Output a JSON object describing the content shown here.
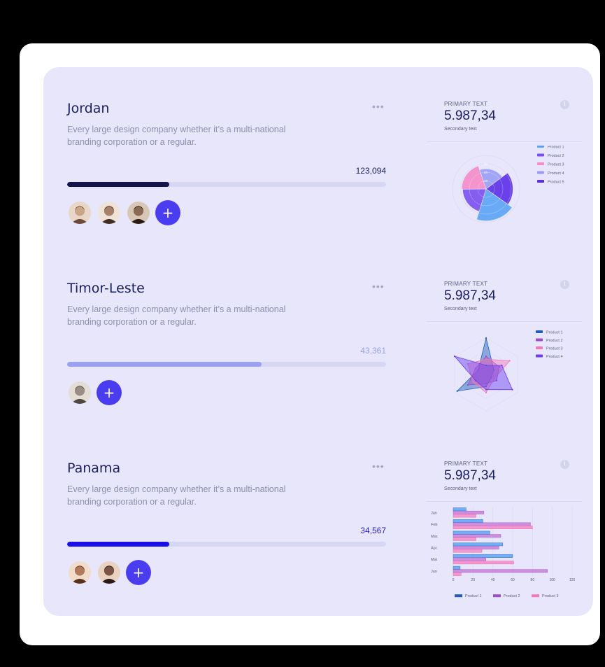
{
  "sections": [
    {
      "title": "Jordan",
      "more": "•••",
      "description": "Every large design company whether it’s a multi-national branding corporation or a regular.",
      "value": "123,094",
      "value_color": "#1a1f5e",
      "progress": 0.32,
      "progress_color": "#14154d",
      "avatar_count": 3,
      "add_label": "+",
      "stat": {
        "label": "PRIMARY TEXT",
        "value": "5.987,34",
        "secondary": "Secondary text",
        "info": "i"
      },
      "chart_data": {
        "type": "polar-area",
        "legend": [
          "Product 1",
          "Product 2",
          "Product 3",
          "Product 4",
          "Product 5"
        ],
        "colors": [
          "#5aa3f5",
          "#7b4ef0",
          "#f58bc7",
          "#9a9cf5",
          "#5b2ee8"
        ],
        "values": [
          38,
          28,
          29,
          24,
          32
        ],
        "r_ticks": [
          10,
          20,
          30
        ],
        "legend_position": "right"
      }
    },
    {
      "title": "Timor-Leste",
      "more": "•••",
      "description": "Every large design company whether it’s a multi-national branding corporation or a regular.",
      "value": "43,361",
      "value_color": "#9a9fe6",
      "progress": 0.61,
      "progress_color": "#9aa0f2",
      "avatar_count": 1,
      "add_label": "+",
      "stat": {
        "label": "PRIMARY TEXT",
        "value": "5.987,34",
        "secondary": "Secondary text",
        "info": "i"
      },
      "chart_data": {
        "type": "radar",
        "legend": [
          "Product 1",
          "Product 2",
          "Product 3",
          "Product 4"
        ],
        "colors": [
          "#1f5db8",
          "#9b4fc9",
          "#f07ab8",
          "#6b3cf0"
        ],
        "series": [
          {
            "name": "Product 1",
            "values": [
              60,
              15,
              10,
              20,
              55,
              15
            ]
          },
          {
            "name": "Product 2",
            "values": [
              30,
              25,
              20,
              15,
              35,
              20
            ]
          },
          {
            "name": "Product 3",
            "values": [
              25,
              45,
              15,
              30,
              25,
              35
            ]
          },
          {
            "name": "Product 4",
            "values": [
              15,
              30,
              50,
              25,
              20,
              60
            ]
          }
        ],
        "legend_position": "right"
      }
    },
    {
      "title": "Panama",
      "more": "•••",
      "description": "Every large design company whether it’s a multi-national branding corporation or a regular.",
      "value": "34,567",
      "value_color": "#2b1fc7",
      "progress": 0.32,
      "progress_color": "#1a0fe6",
      "avatar_count": 2,
      "add_label": "+",
      "stat": {
        "label": "PRIMARY TEXT",
        "value": "5.987,34",
        "secondary": "Secondary text",
        "info": "i"
      },
      "chart_data": {
        "type": "bar",
        "orientation": "horizontal",
        "categories": [
          "Jan",
          "Feb",
          "Mar.",
          "Apr.",
          "Mai",
          "Jun"
        ],
        "x_ticks": [
          0,
          20,
          40,
          60,
          80,
          100,
          120
        ],
        "xlim": [
          0,
          120
        ],
        "legend": [
          "Product 1",
          "Product 2",
          "Product 3"
        ],
        "colors": [
          "#5aa3f5",
          "#c77fd8",
          "#f58bc7"
        ],
        "series": [
          {
            "name": "Product 1",
            "values": [
              13,
              30,
              37,
              50,
              60,
              7
            ]
          },
          {
            "name": "Product 2",
            "values": [
              31,
              78,
              48,
              46,
              33,
              95
            ]
          },
          {
            "name": "Product 3",
            "values": [
              23,
              80,
              23,
              29,
              61,
              8
            ]
          }
        ],
        "legend_position": "bottom"
      }
    }
  ]
}
